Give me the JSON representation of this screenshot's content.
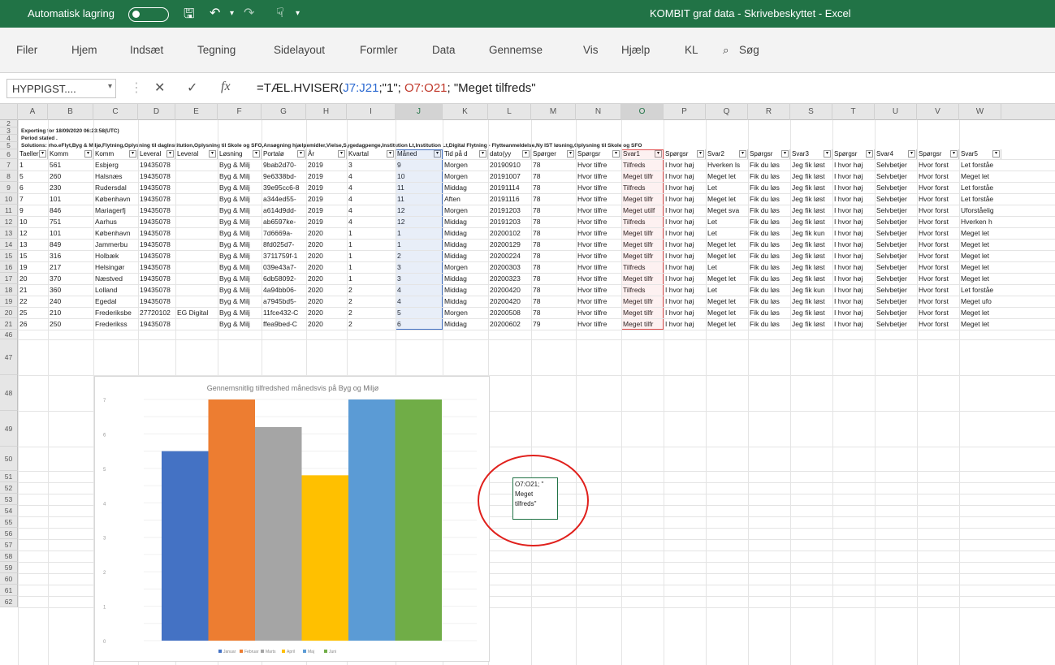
{
  "titlebar": {
    "autosave_label": "Automatisk lagring",
    "title": "KOMBIT graf data  -  Skrivebeskyttet  -  Excel"
  },
  "ribbon": {
    "tabs": [
      "Filer",
      "Hjem",
      "Indsæt",
      "Tegning",
      "Sidelayout",
      "Formler",
      "Data",
      "Gennemse",
      "Vis",
      "Hjælp",
      "KL"
    ],
    "search_label": "Søg"
  },
  "formulabar": {
    "namebox": "HYPPIGST....",
    "fx": "fx",
    "f_prefix": "=TÆL.HVISER(",
    "f_range1": "J7:J21",
    "f_mid": ";\"1\"; ",
    "f_range2": "O7:O21",
    "f_suffix": "; \"Meget tilfreds\""
  },
  "columns": [
    "A",
    "B",
    "C",
    "D",
    "E",
    "F",
    "G",
    "H",
    "I",
    "J",
    "K",
    "L",
    "M",
    "N",
    "O",
    "P",
    "Q",
    "R",
    "S",
    "T",
    "U",
    "V",
    "W"
  ],
  "meta_rows": [
    {
      "row": "3",
      "text": "Exporting for 18/09/2020 06:23:58(UTC)"
    },
    {
      "row": "4",
      "text": "Period stated ."
    },
    {
      "row": "5",
      "text": "Solutions: rho.eFlyt,Byg & Miljø,Flytning,Oplysning til dagInstitution,Oplysning til Skole og SFO,Ansøgning hjælpemidler,Vielse,Sygedagpenge,Institution Lt,Institution Lt,Digital Flytning - Flytteanmeldelse,Ny IST løsning,Oplysning til Skole og SFO"
    }
  ],
  "table_headers": [
    "Taeller",
    "Komm",
    "Komm",
    "Leveral",
    "Leveral",
    "Løsning",
    "Portalø",
    "År",
    "Kvartal",
    "Måned",
    "Tid på d",
    "dato(yy",
    "Spørger",
    "Spørgsr",
    "Svar1",
    "Spørgsr",
    "Svar2",
    "Spørgsr",
    "Svar3",
    "Spørgsr",
    "Svar4",
    "Spørgsr",
    "Svar5"
  ],
  "row_numbers": [
    "7",
    "8",
    "9",
    "10",
    "11",
    "12",
    "13",
    "14",
    "15",
    "16",
    "17",
    "18",
    "19",
    "20",
    "21"
  ],
  "rows": [
    [
      "1",
      "561",
      "Esbjerg",
      "19435078",
      "",
      "Byg & Milj",
      "9bab2d70-",
      "2019",
      "3",
      "9",
      "Morgen",
      "20190910",
      "78",
      "Hvor tilfre",
      "Tilfreds",
      "I hvor høj",
      "Hverken ls",
      "Fik du løs",
      "Jeg fik løst",
      "I hvor høj",
      "Selvbetjer",
      "Hvor forst",
      "Let forståe"
    ],
    [
      "5",
      "260",
      "Halsnæs",
      "19435078",
      "",
      "Byg & Milj",
      "9e6338bd-",
      "2019",
      "4",
      "10",
      "Morgen",
      "20191007",
      "78",
      "Hvor tilfre",
      "Meget tilfr",
      "I hvor høj",
      "Meget let",
      "Fik du løs",
      "Jeg fik løst",
      "I hvor høj",
      "Selvbetjer",
      "Hvor forst",
      "Meget let"
    ],
    [
      "6",
      "230",
      "Rudersdal",
      "19435078",
      "",
      "Byg & Milj",
      "39e95cc6-8",
      "2019",
      "4",
      "11",
      "Middag",
      "20191114",
      "78",
      "Hvor tilfre",
      "Tilfreds",
      "I hvor høj",
      "Let",
      "Fik du løs",
      "Jeg fik løst",
      "I hvor høj",
      "Selvbetjer",
      "Hvor forst",
      "Let forståe"
    ],
    [
      "7",
      "101",
      "København",
      "19435078",
      "",
      "Byg & Milj",
      "a344ed55-",
      "2019",
      "4",
      "11",
      "Aften",
      "20191116",
      "78",
      "Hvor tilfre",
      "Meget tilfr",
      "I hvor høj",
      "Meget let",
      "Fik du løs",
      "Jeg fik løst",
      "I hvor høj",
      "Selvbetjer",
      "Hvor forst",
      "Let forståe"
    ],
    [
      "9",
      "846",
      "Mariagerfj",
      "19435078",
      "",
      "Byg & Milj",
      "a614d9dd-",
      "2019",
      "4",
      "12",
      "Morgen",
      "20191203",
      "78",
      "Hvor tilfre",
      "Meget utilf",
      "I hvor høj",
      "Meget sva",
      "Fik du løs",
      "Jeg fik løst",
      "I hvor høj",
      "Selvbetjer",
      "Hvor forst",
      "Uforståelig"
    ],
    [
      "10",
      "751",
      "Aarhus",
      "19435078",
      "",
      "Byg & Milj",
      "ab6597ke-",
      "2019",
      "4",
      "12",
      "Middag",
      "20191203",
      "78",
      "Hvor tilfre",
      "Tilfreds",
      "I hvor høj",
      "Let",
      "Fik du løs",
      "Jeg fik løst",
      "I hvor høj",
      "Selvbetjer",
      "Hvor forst",
      "Hverken h"
    ],
    [
      "12",
      "101",
      "København",
      "19435078",
      "",
      "Byg & Milj",
      "7d6669a-",
      "2020",
      "1",
      "1",
      "Middag",
      "20200102",
      "78",
      "Hvor tilfre",
      "Meget tilfr",
      "I hvor høj",
      "Let",
      "Fik du løs",
      "Jeg fik kun",
      "I hvor høj",
      "Selvbetjer",
      "Hvor forst",
      "Meget let"
    ],
    [
      "13",
      "849",
      "Jammerbu",
      "19435078",
      "",
      "Byg & Milj",
      "8fd025d7-",
      "2020",
      "1",
      "1",
      "Middag",
      "20200129",
      "78",
      "Hvor tilfre",
      "Meget tilfr",
      "I hvor høj",
      "Meget let",
      "Fik du løs",
      "Jeg fik løst",
      "I hvor høj",
      "Selvbetjer",
      "Hvor forst",
      "Meget let"
    ],
    [
      "15",
      "316",
      "Holbæk",
      "19435078",
      "",
      "Byg & Milj",
      "3711759f-1",
      "2020",
      "1",
      "2",
      "Middag",
      "20200224",
      "78",
      "Hvor tilfre",
      "Meget tilfr",
      "I hvor høj",
      "Meget let",
      "Fik du løs",
      "Jeg fik løst",
      "I hvor høj",
      "Selvbetjer",
      "Hvor forst",
      "Meget let"
    ],
    [
      "19",
      "217",
      "Helsingør",
      "19435078",
      "",
      "Byg & Milj",
      "039e43a7-",
      "2020",
      "1",
      "3",
      "Morgen",
      "20200303",
      "78",
      "Hvor tilfre",
      "Tilfreds",
      "I hvor høj",
      "Let",
      "Fik du løs",
      "Jeg fik løst",
      "I hvor høj",
      "Selvbetjer",
      "Hvor forst",
      "Meget let"
    ],
    [
      "20",
      "370",
      "Næstved",
      "19435078",
      "",
      "Byg & Milj",
      "6db58092-",
      "2020",
      "1",
      "3",
      "Middag",
      "20200323",
      "78",
      "Hvor tilfre",
      "Meget tilfr",
      "I hvor høj",
      "Meget let",
      "Fik du løs",
      "Jeg fik løst",
      "I hvor høj",
      "Selvbetjer",
      "Hvor forst",
      "Meget let"
    ],
    [
      "21",
      "360",
      "Lolland",
      "19435078",
      "",
      "Byg & Milj",
      "4a94bb06-",
      "2020",
      "2",
      "4",
      "Middag",
      "20200420",
      "78",
      "Hvor tilfre",
      "Tilfreds",
      "I hvor høj",
      "Let",
      "Fik du løs",
      "Jeg fik kun",
      "I hvor høj",
      "Selvbetjer",
      "Hvor forst",
      "Let forståe"
    ],
    [
      "22",
      "240",
      "Egedal",
      "19435078",
      "",
      "Byg & Milj",
      "a7945bd5-",
      "2020",
      "2",
      "4",
      "Middag",
      "20200420",
      "78",
      "Hvor tilfre",
      "Meget tilfr",
      "I hvor høj",
      "Meget let",
      "Fik du løs",
      "Jeg fik løst",
      "I hvor høj",
      "Selvbetjer",
      "Hvor forst",
      "Meget ufo"
    ],
    [
      "25",
      "210",
      "Frederiksbe",
      "27720102",
      "EG Digital",
      "Byg & Milj",
      "11fce432-C",
      "2020",
      "2",
      "5",
      "Morgen",
      "20200508",
      "78",
      "Hvor tilfre",
      "Meget tilfr",
      "I hvor høj",
      "Meget let",
      "Fik du løs",
      "Jeg fik løst",
      "I hvor høj",
      "Selvbetjer",
      "Hvor forst",
      "Meget let"
    ],
    [
      "26",
      "250",
      "Frederikss",
      "19435078",
      "",
      "Byg & Milj",
      "ffea9bed-C",
      "2020",
      "2",
      "6",
      "Middag",
      "20200602",
      "79",
      "Hvor tilfre",
      "Meget tilfr",
      "I hvor høj",
      "Meget let",
      "Fik du løs",
      "Jeg fik løst",
      "I hvor høj",
      "Selvbetjer",
      "Hvor forst",
      "Meget let"
    ]
  ],
  "lower_row_numbers": [
    "46",
    "47",
    "48",
    "49",
    "50",
    "51",
    "52",
    "53",
    "54",
    "55",
    "56",
    "57",
    "58",
    "59",
    "60",
    "61",
    "62"
  ],
  "tip_cell": {
    "line1": "O7:O21; \"",
    "line2": "Meget",
    "line3": "tilfreds\""
  },
  "chart_data": {
    "type": "bar",
    "title": "Gennemsnitlig tilfredshed månedsvis på Byg og Miljø",
    "categories": [
      "Januar",
      "Februar",
      "Marts",
      "April",
      "Maj",
      "Juni"
    ],
    "values": [
      5.5,
      7,
      6.2,
      4.8,
      7,
      7
    ],
    "ylim": [
      0,
      7
    ],
    "yticks": [
      "0",
      "0.5",
      "1",
      "1.5",
      "2",
      "2.5",
      "3",
      "3.5",
      "4",
      "4.5",
      "5",
      "5.5",
      "6",
      "6.5",
      "7"
    ],
    "colors": [
      "#4472c4",
      "#ed7d31",
      "#a5a5a5",
      "#ffc000",
      "#5b9bd5",
      "#70ad47"
    ],
    "gridlines": true,
    "legend_position": "bottom"
  }
}
